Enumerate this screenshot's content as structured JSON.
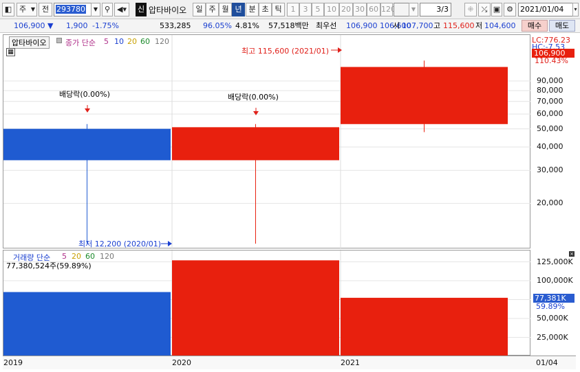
{
  "toolbar": {
    "type_select": "주",
    "prev_label": "전",
    "code": "293780",
    "credit_badge": "신",
    "stock_name": "압타바이오",
    "period_buttons": [
      "일",
      "주",
      "월",
      "년",
      "분",
      "초",
      "틱"
    ],
    "active_period": "년",
    "interval_buttons": [
      "1",
      "3",
      "5",
      "10",
      "20",
      "30",
      "60",
      "120"
    ],
    "page": "3/3",
    "date": "2021/01/04"
  },
  "quote": {
    "price": "106,900 ▼",
    "change": "1,900",
    "change_pct": "-1.75%",
    "volume": "533,285",
    "vol_ratio": "96.05%",
    "turnover_pct": "4.81%",
    "amount": "57,518백만",
    "best_label": "최우선",
    "best_ask": "106,900",
    "best_bid": "106,600",
    "open_label": "시",
    "open": "107,700",
    "high_label": "고",
    "high": "115,600",
    "low_label": "저",
    "low": "104,600",
    "buy_label": "매수",
    "sell_label": "매도"
  },
  "price_legend": {
    "name": "압타바이오",
    "ma_label": "종가 단순",
    "ma_periods": [
      "5",
      "10",
      "20",
      "60",
      "120"
    ]
  },
  "volume_legend": {
    "label": "거래량 단순",
    "ma_periods": [
      "5",
      "20",
      "60",
      "120"
    ],
    "current": "77,380,524주(59.89%)"
  },
  "annotations": {
    "dividend_1": "배당락(0.00%)",
    "dividend_2": "배당락(0.00%)",
    "high_note": "최고 115,600 (2021/01)",
    "low_note": "최저 12,200 (2020/01)"
  },
  "axis": {
    "lc": "LC:776.23",
    "hc": "HC:-7.53",
    "price_tag": "106,900",
    "price_tag_pct": "110.43%",
    "price_ticks": [
      "90,000",
      "80,000",
      "70,000",
      "60,000",
      "50,000",
      "40,000",
      "30,000",
      "20,000"
    ],
    "volume_ticks": [
      "125,000K",
      "100,000K",
      "75,000K",
      "50,000K",
      "25,000K"
    ],
    "vol_tag": "77,381K",
    "vol_tag_pct": "59.89%",
    "x_labels": [
      "2019",
      "2020",
      "2021"
    ],
    "x_right_label": "01/04"
  },
  "chart_data": {
    "type": "candlestick",
    "categories": [
      "2019",
      "2020",
      "2021"
    ],
    "series": [
      {
        "name": "압타바이오",
        "open": [
          50000,
          34000,
          53000
        ],
        "high": [
          53000,
          53000,
          115600
        ],
        "low": [
          12200,
          12200,
          48000
        ],
        "close": [
          34000,
          51000,
          106900
        ]
      }
    ],
    "volume": [
      85000000,
      127000000,
      77380524
    ],
    "y_scale": "log",
    "ylim": [
      12000,
      125000
    ],
    "volume_ylim": [
      0,
      140000000
    ],
    "colors": {
      "up": "#e8200e",
      "down": "#1f5bd1"
    }
  }
}
